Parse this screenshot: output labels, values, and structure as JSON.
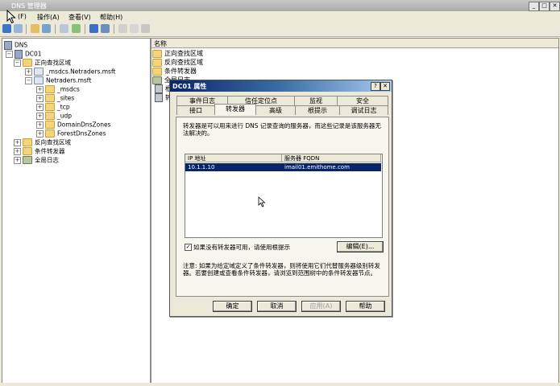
{
  "window": {
    "title": "DNS 管理器",
    "min": "_",
    "max": "□",
    "close": "✕"
  },
  "menu": {
    "file": "(F)",
    "action": "操作(A)",
    "view": "查看(V)",
    "help": "帮助(H)"
  },
  "tree": {
    "root": "DNS",
    "server": "DC01",
    "forward": "正向查找区域",
    "msdcs_zone": "_msdcs.Netraders.msft",
    "zone": "Netraders.msft",
    "children": [
      "_msdcs",
      "_sites",
      "_tcp",
      "_udp",
      "DomainDnsZones",
      "ForestDnsZones"
    ],
    "reverse": "反向查找区域",
    "conditional": "条件转发器",
    "global_logs": "全局日志"
  },
  "list": {
    "column_name": "名称",
    "items": [
      "正向查找区域",
      "反向查找区域",
      "条件转发器",
      "全局日志"
    ],
    "partial_items": [
      "根",
      "转"
    ]
  },
  "dialog": {
    "title": "DC01 属性",
    "help_btn": "?",
    "close_btn": "✕",
    "tabs_row1": [
      "事件日志",
      "信任定位点",
      "监视",
      "安全"
    ],
    "tabs_row2": [
      "接口",
      "转发器",
      "高级",
      "根提示",
      "调试日志"
    ],
    "description": "转发器是可以用来进行 DNS 记录查询的服务器，而这些记录是该服务器无法解决的。",
    "col_ip": "IP 地址",
    "col_fqdn": "服务器 FQDN",
    "rows": [
      {
        "ip": "10.1.1.10",
        "fqdn": "imail01.emithome.com"
      }
    ],
    "checkbox_label": "如果没有转发器可用，请使用根提示",
    "checkbox_checked": "✓",
    "edit_button": "编辑(E)...",
    "note": "注意: 如果为给定域定义了条件转发器，则将使用它们代替服务器级别转发器。若要创建或查看条件转发器，请浏览到范围树中的条件转发器节点。",
    "ok": "确定",
    "cancel": "取消",
    "apply": "应用(A)",
    "help": "帮助"
  }
}
